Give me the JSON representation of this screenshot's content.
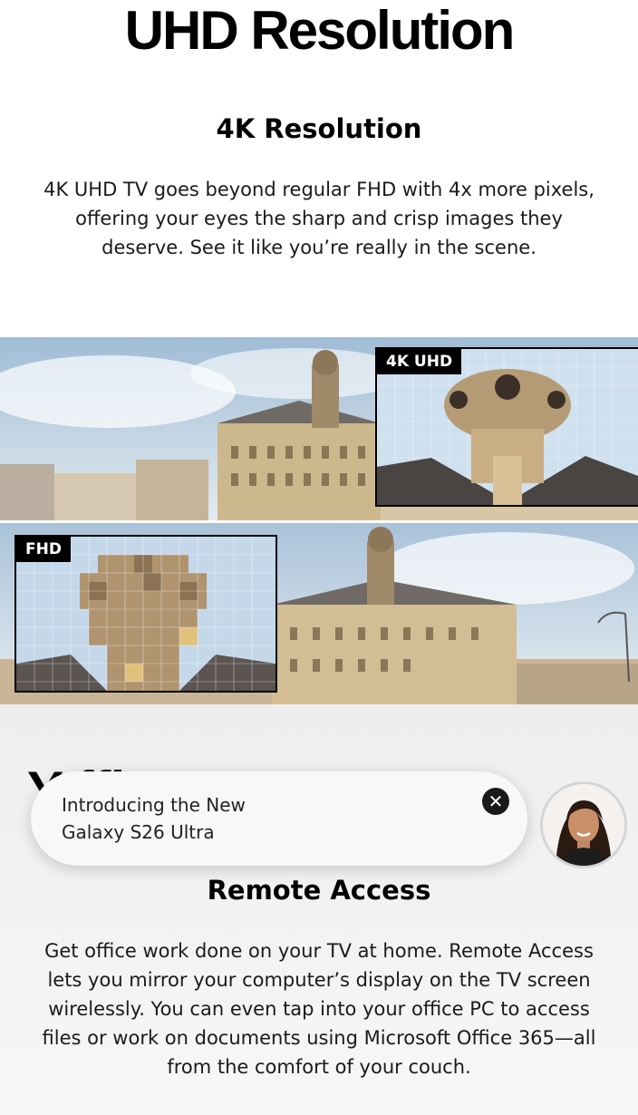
{
  "hero": {
    "headline": "UHD Resolution",
    "feature_title": "4K Resolution",
    "feature_body": "4K UHD TV goes beyond regular FHD with 4x more pixels, offering your eyes the sharp and crisp images they deserve. See it like you’re really in the scene."
  },
  "comparison": {
    "uhd_label": "4K UHD",
    "fhd_label": "FHD"
  },
  "office": {
    "section_title_partial": "Y          ffice",
    "feature_title": "Remote Access",
    "feature_body": "Get office work done on your TV at home. Remote Access lets you mirror your computer’s display on the TV screen wirelessly. You can even tap into your office PC to access files or work on documents using Microsoft Office 365—all from the comfort of your couch."
  },
  "promo": {
    "line1": "Introducing the New",
    "line2": "Galaxy S26 Ultra",
    "close_glyph": "✕"
  }
}
